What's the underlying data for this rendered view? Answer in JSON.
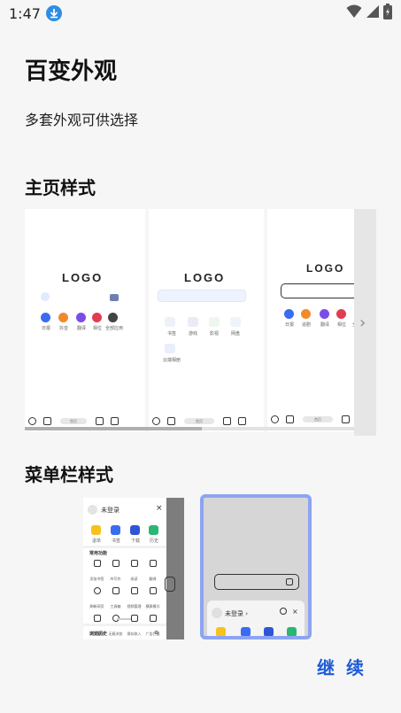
{
  "status_bar": {
    "time": "1:47"
  },
  "title": "百变外观",
  "subtitle": "多套外观可供选择",
  "home_section": {
    "title": "主页样式",
    "cards": [
      {
        "logo": "LOGO",
        "apps": [
          "日报",
          "抖音",
          "翻译",
          "相位",
          "全部应用"
        ],
        "nav_pill": "首页"
      },
      {
        "logo": "LOGO",
        "apps": [
          "书签",
          "游戏",
          "影视",
          "网盘",
          "云端相册"
        ],
        "nav_pill": "首页"
      },
      {
        "logo": "LOGO",
        "apps": [
          "日报",
          "追剧",
          "翻译",
          "相位",
          "全部"
        ],
        "nav_pill": "首页"
      }
    ]
  },
  "menu_section": {
    "title": "菜单栏样式",
    "style1": {
      "login": "未登录",
      "top_items": [
        "退单",
        "书签",
        "下载",
        "历史"
      ],
      "tools_title": "常用功能",
      "tools": [
        "添加书签",
        "AI写作",
        "阅读",
        "翻译",
        "刷新网页",
        "工具箱",
        "视频管理",
        "横屏模式",
        "网页截图",
        "无痕浏览",
        "保存收入",
        "广告拦截"
      ],
      "history": "浏览历史"
    },
    "style2": {
      "login": "未登录 ›"
    }
  },
  "continue_label": "继 续",
  "colors": {
    "accent": "#1e5bd6",
    "selected_border": "#8da4f3"
  }
}
